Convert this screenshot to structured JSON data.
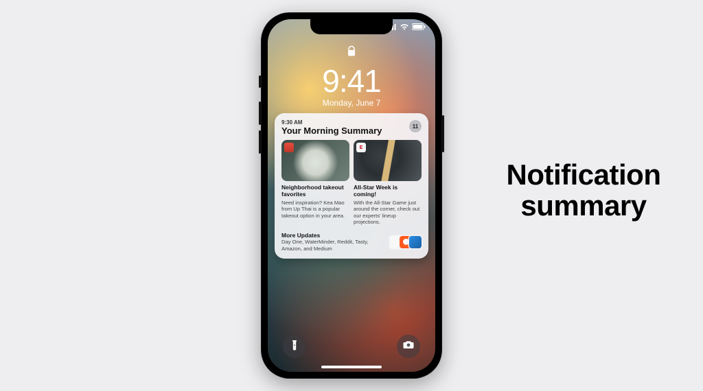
{
  "headline": {
    "line1": "Notification",
    "line2": "summary"
  },
  "lockscreen": {
    "time": "9:41",
    "date": "Monday, June 7"
  },
  "summary": {
    "timestamp": "9:30 AM",
    "title": "Your Morning Summary",
    "count": "11",
    "cards": [
      {
        "title": "Neighborhood takeout favorites",
        "body": "Need inspiration? Kea Mao from Up Thai is a popular takeout option in your area.",
        "badge": "red",
        "thumb": "food"
      },
      {
        "title": "All-Star Week is coming!",
        "body": "With the All-Star Game just around the corner, check out our experts' lineup projections.",
        "badge": "E",
        "thumb": "bat"
      }
    ],
    "more": {
      "title": "More Updates",
      "body": "Day One, WaterMinder, Reddit, Tasty, Amazon, and Medium"
    }
  }
}
